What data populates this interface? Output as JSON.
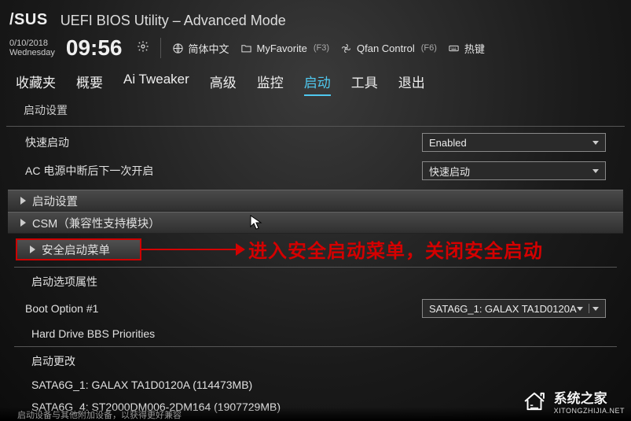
{
  "header": {
    "brand": "/SUS",
    "title": "UEFI BIOS Utility – Advanced Mode",
    "date": "0/10/2018",
    "weekday": "Wednesday",
    "time": "09:56"
  },
  "topbar": {
    "language": "简体中文",
    "favorite": "MyFavorite",
    "favorite_hint": "(F3)",
    "qfan": "Qfan Control",
    "qfan_hint": "(F6)",
    "hotkey": "热键"
  },
  "tabs": [
    {
      "label": "收藏夹",
      "active": false
    },
    {
      "label": "概要",
      "active": false
    },
    {
      "label": "Ai Tweaker",
      "active": false
    },
    {
      "label": "高级",
      "active": false
    },
    {
      "label": "监控",
      "active": false
    },
    {
      "label": "启动",
      "active": true
    },
    {
      "label": "工具",
      "active": false
    },
    {
      "label": "退出",
      "active": false
    }
  ],
  "page": {
    "subheading": "启动设置",
    "fast_boot": {
      "label": "快速启动",
      "value": "Enabled"
    },
    "ac_power": {
      "label": "AC 电源中断后下一次开启",
      "value": "快速启动"
    },
    "sections": {
      "boot_cfg": "启动设置",
      "csm": "CSM（兼容性支持模块）",
      "secure_boot": "安全启动菜单"
    },
    "annotation": "进入安全启动菜单，关闭安全启动",
    "boot_opt_head": "启动选项属性",
    "boot_opt1": {
      "label": "Boot Option #1",
      "value": "SATA6G_1: GALAX TA1D0120A"
    },
    "hdd_prio": "Hard Drive BBS Priorities",
    "boot_change": "启动更改",
    "drives": [
      "SATA6G_1: GALAX TA1D0120A  (114473MB)",
      "SATA6G_4: ST2000DM006-2DM164  (1907729MB)"
    ],
    "truncated_hint": "启动设备与其他附加设备，以获得更好兼容"
  },
  "watermark": {
    "name": "系统之家",
    "url": "XITONGZHIJIA.NET"
  }
}
